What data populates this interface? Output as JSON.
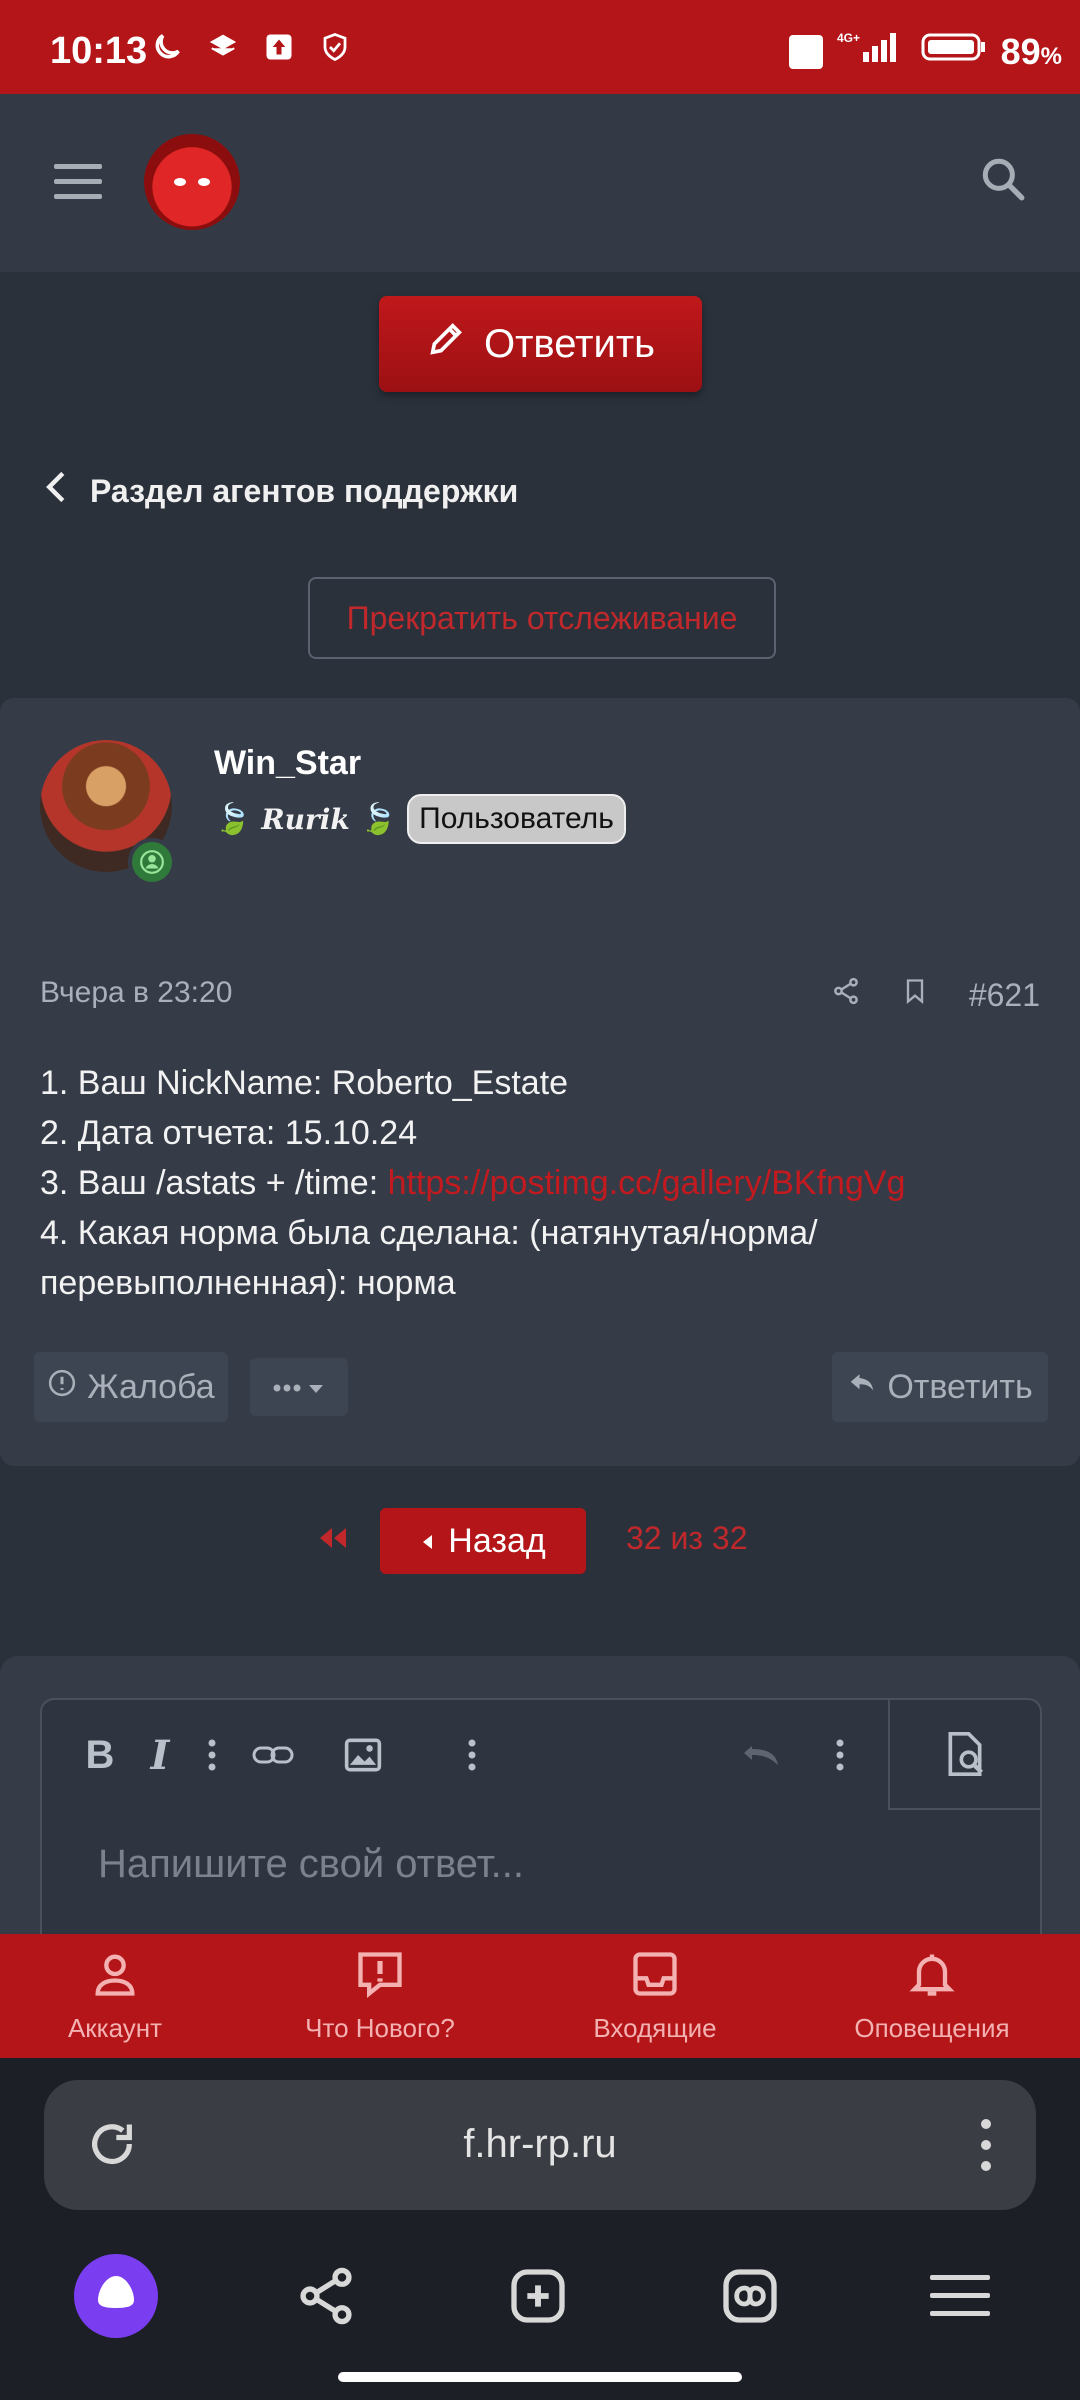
{
  "status_bar": {
    "time": "10:13",
    "battery": "89",
    "battery_unit": "%",
    "network": "4G+"
  },
  "header": {
    "menu_icon": "hamburger-icon",
    "logo_icon": "bear-logo",
    "search_icon": "search-icon"
  },
  "reply_button": {
    "label": "Ответить"
  },
  "breadcrumb": {
    "label": "Раздел агентов поддержки"
  },
  "unwatch_button": {
    "label": "Прекратить отслеживание"
  },
  "post": {
    "author": "Win_Star",
    "user_title": "Rurik",
    "badge": "Пользователь",
    "time": "Вчера в 23:20",
    "number": "#621",
    "lines": [
      "1. Ваш NickName: Roberto_Estate",
      "2. Дата отчета: 15.10.24",
      "3. Ваш /astats + /time: ",
      "4. Какая норма была сделана: (натянутая/норма/",
      "перевыполненная): норма"
    ],
    "link": "https://postimg.cc/gallery/BKfngVg",
    "report_label": "Жалоба",
    "reply_label": "Ответить"
  },
  "pagination": {
    "back_label": "Назад",
    "info": "32 из 32"
  },
  "editor": {
    "placeholder": "Напишите свой ответ..."
  },
  "forum_nav": {
    "items": [
      {
        "label": "Аккаунт",
        "icon": "user-icon"
      },
      {
        "label": "Что Нового?",
        "icon": "alert-bubble-icon"
      },
      {
        "label": "Входящие",
        "icon": "inbox-icon"
      },
      {
        "label": "Оповещения",
        "icon": "bell-icon"
      }
    ]
  },
  "browser": {
    "url": "f.hr-rp.ru"
  },
  "colors": {
    "accent": "#b41518",
    "link": "#c21a1e",
    "bg": "#2b313b",
    "panel": "#353c48"
  }
}
